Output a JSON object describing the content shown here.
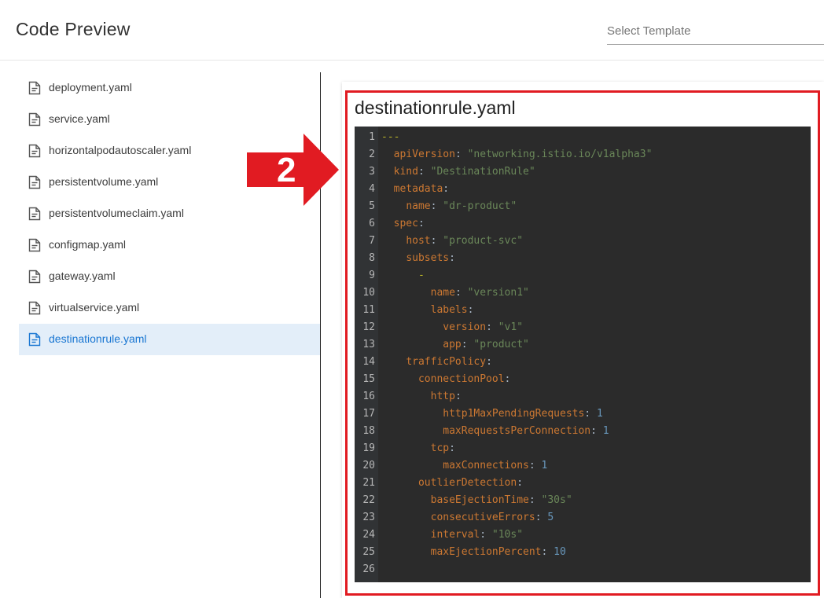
{
  "header": {
    "title": "Code Preview",
    "template_placeholder": "Select Template"
  },
  "files": [
    {
      "name": "deployment.yaml",
      "active": false
    },
    {
      "name": "service.yaml",
      "active": false
    },
    {
      "name": "horizontalpodautoscaler.yaml",
      "active": false
    },
    {
      "name": "persistentvolume.yaml",
      "active": false
    },
    {
      "name": "persistentvolumeclaim.yaml",
      "active": false
    },
    {
      "name": "configmap.yaml",
      "active": false
    },
    {
      "name": "gateway.yaml",
      "active": false
    },
    {
      "name": "virtualservice.yaml",
      "active": false
    },
    {
      "name": "destinationrule.yaml",
      "active": true
    }
  ],
  "preview": {
    "title": "destinationrule.yaml",
    "lines": [
      [
        [
          "d",
          "---"
        ]
      ],
      [
        [
          "p",
          "  "
        ],
        [
          "k",
          "apiVersion"
        ],
        [
          "p",
          ": "
        ],
        [
          "s",
          "\"networking.istio.io/v1alpha3\""
        ]
      ],
      [
        [
          "p",
          "  "
        ],
        [
          "k",
          "kind"
        ],
        [
          "p",
          ": "
        ],
        [
          "s",
          "\"DestinationRule\""
        ]
      ],
      [
        [
          "p",
          "  "
        ],
        [
          "k",
          "metadata"
        ],
        [
          "p",
          ":"
        ]
      ],
      [
        [
          "p",
          "    "
        ],
        [
          "k",
          "name"
        ],
        [
          "p",
          ": "
        ],
        [
          "s",
          "\"dr-product\""
        ]
      ],
      [
        [
          "p",
          "  "
        ],
        [
          "k",
          "spec"
        ],
        [
          "p",
          ":"
        ]
      ],
      [
        [
          "p",
          "    "
        ],
        [
          "k",
          "host"
        ],
        [
          "p",
          ": "
        ],
        [
          "s",
          "\"product-svc\""
        ]
      ],
      [
        [
          "p",
          "    "
        ],
        [
          "k",
          "subsets"
        ],
        [
          "p",
          ":"
        ]
      ],
      [
        [
          "p",
          "      "
        ],
        [
          "d",
          "-"
        ]
      ],
      [
        [
          "p",
          "        "
        ],
        [
          "k",
          "name"
        ],
        [
          "p",
          ": "
        ],
        [
          "s",
          "\"version1\""
        ]
      ],
      [
        [
          "p",
          "        "
        ],
        [
          "k",
          "labels"
        ],
        [
          "p",
          ":"
        ]
      ],
      [
        [
          "p",
          "          "
        ],
        [
          "k",
          "version"
        ],
        [
          "p",
          ": "
        ],
        [
          "s",
          "\"v1\""
        ]
      ],
      [
        [
          "p",
          "          "
        ],
        [
          "k",
          "app"
        ],
        [
          "p",
          ": "
        ],
        [
          "s",
          "\"product\""
        ]
      ],
      [
        [
          "p",
          "    "
        ],
        [
          "k",
          "trafficPolicy"
        ],
        [
          "p",
          ":"
        ]
      ],
      [
        [
          "p",
          "      "
        ],
        [
          "k",
          "connectionPool"
        ],
        [
          "p",
          ":"
        ]
      ],
      [
        [
          "p",
          "        "
        ],
        [
          "k",
          "http"
        ],
        [
          "p",
          ":"
        ]
      ],
      [
        [
          "p",
          "          "
        ],
        [
          "k",
          "http1MaxPendingRequests"
        ],
        [
          "p",
          ": "
        ],
        [
          "n",
          "1"
        ]
      ],
      [
        [
          "p",
          "          "
        ],
        [
          "k",
          "maxRequestsPerConnection"
        ],
        [
          "p",
          ": "
        ],
        [
          "n",
          "1"
        ]
      ],
      [
        [
          "p",
          "        "
        ],
        [
          "k",
          "tcp"
        ],
        [
          "p",
          ":"
        ]
      ],
      [
        [
          "p",
          "          "
        ],
        [
          "k",
          "maxConnections"
        ],
        [
          "p",
          ": "
        ],
        [
          "n",
          "1"
        ]
      ],
      [
        [
          "p",
          "      "
        ],
        [
          "k",
          "outlierDetection"
        ],
        [
          "p",
          ":"
        ]
      ],
      [
        [
          "p",
          "        "
        ],
        [
          "k",
          "baseEjectionTime"
        ],
        [
          "p",
          ": "
        ],
        [
          "s",
          "\"30s\""
        ]
      ],
      [
        [
          "p",
          "        "
        ],
        [
          "k",
          "consecutiveErrors"
        ],
        [
          "p",
          ": "
        ],
        [
          "n",
          "5"
        ]
      ],
      [
        [
          "p",
          "        "
        ],
        [
          "k",
          "interval"
        ],
        [
          "p",
          ": "
        ],
        [
          "s",
          "\"10s\""
        ]
      ],
      [
        [
          "p",
          "        "
        ],
        [
          "k",
          "maxEjectionPercent"
        ],
        [
          "p",
          ": "
        ],
        [
          "n",
          "10"
        ]
      ],
      []
    ]
  },
  "annotation": {
    "number": "2",
    "color": "#e11b22"
  },
  "colors": {
    "accent": "#1976d2",
    "active_bg": "#e3eef9",
    "code_bg": "#2b2b2b"
  }
}
